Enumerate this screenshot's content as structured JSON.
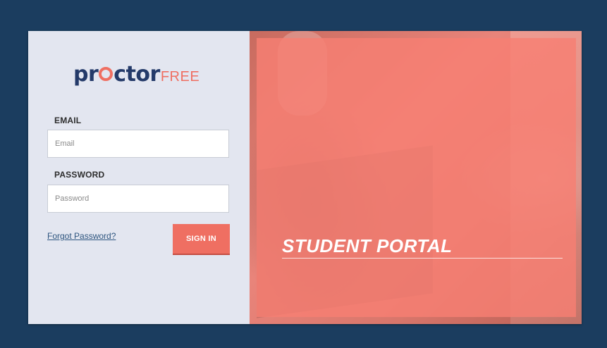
{
  "logo": {
    "part1": "pr",
    "part2": "ctor",
    "part3": "FREE"
  },
  "form": {
    "email_label": "EMAIL",
    "email_placeholder": "Email",
    "email_value": "",
    "password_label": "PASSWORD",
    "password_placeholder": "Password",
    "password_value": "",
    "forgot_link": "Forgot Password?",
    "signin_label": "SIGN IN"
  },
  "hero": {
    "title": "STUDENT PORTAL"
  },
  "colors": {
    "background": "#1b3d5f",
    "panel": "#e3e6f0",
    "accent": "#ef6f62",
    "brand_navy": "#243a69",
    "link": "#2e557f"
  }
}
